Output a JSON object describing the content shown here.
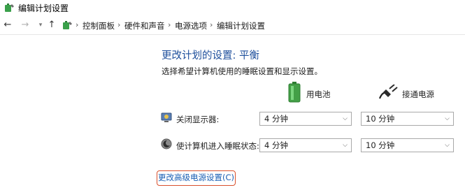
{
  "window": {
    "title": "编辑计划设置"
  },
  "breadcrumb": [
    "控制面板",
    "硬件和声音",
    "电源选项",
    "编辑计划设置"
  ],
  "heading": "更改计划的设置: 平衡",
  "subtext": "选择希望计算机使用的睡眠设置和显示设置。",
  "columns": {
    "battery": "用电池",
    "plugged": "接通电源"
  },
  "rows": [
    {
      "label": "关闭显示器:",
      "battery_value": "4 分钟",
      "plugged_value": "10 分钟"
    },
    {
      "label": "使计算机进入睡眠状态:",
      "battery_value": "4 分钟",
      "plugged_value": "10 分钟"
    }
  ],
  "advanced_link": "更改高级电源设置(C)",
  "icons": {
    "app": "power-plan-icon",
    "battery": "battery-icon",
    "plug": "power-plug-icon",
    "display": "display-icon",
    "sleep": "sleep-icon"
  }
}
